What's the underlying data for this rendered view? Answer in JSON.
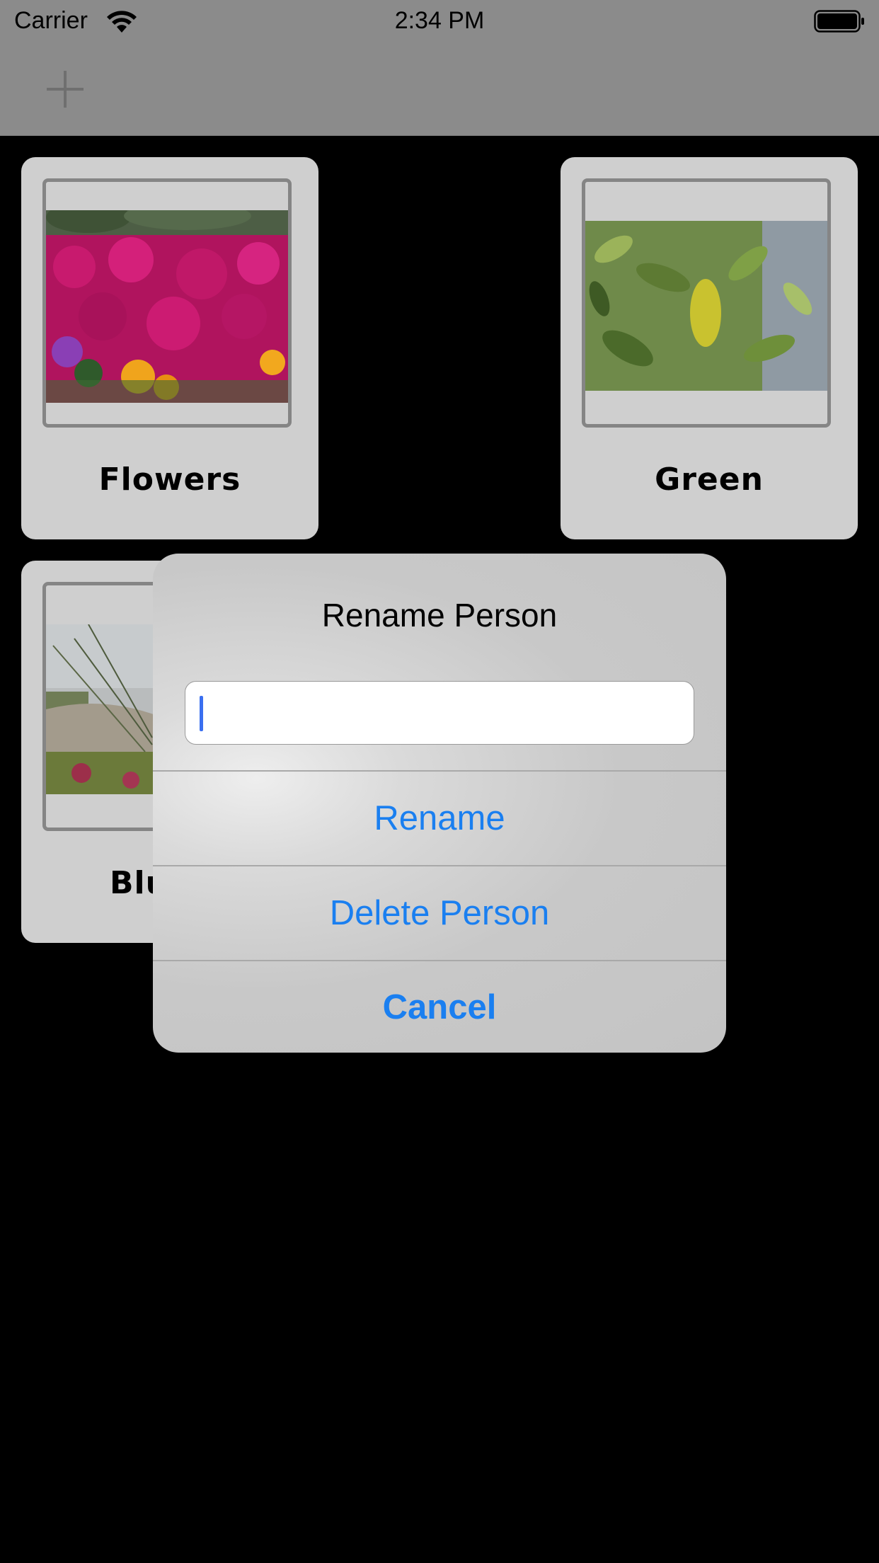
{
  "status_bar": {
    "carrier": "Carrier",
    "time": "2:34 PM"
  },
  "nav_bar": {
    "add_icon": "plus-icon"
  },
  "people": [
    {
      "name": "Flowers"
    },
    {
      "name": "Green"
    },
    {
      "name": "Blu"
    }
  ],
  "alert": {
    "title": "Rename Person",
    "input_value": "",
    "actions": {
      "rename": "Rename",
      "delete": "Delete Person",
      "cancel": "Cancel"
    }
  },
  "colors": {
    "accent": "#1a7ff0",
    "background": "#000000",
    "card": "#cfcfcf"
  }
}
